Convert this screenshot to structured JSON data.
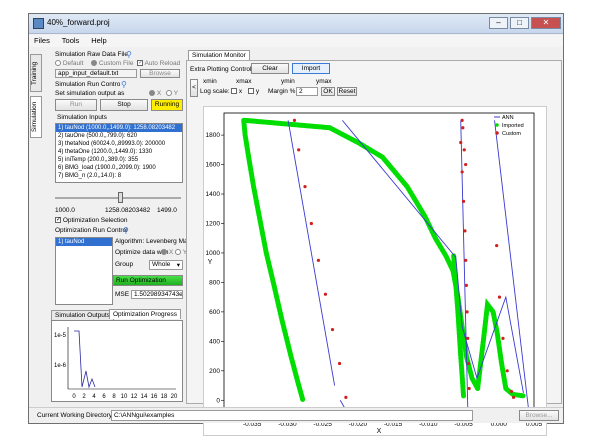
{
  "window": {
    "title": "40%_forward.proj"
  },
  "menu": [
    "Files",
    "Tools",
    "Help"
  ],
  "side_tabs": {
    "training": "Training",
    "simulation": "Simulation"
  },
  "raw_data": {
    "header": "Simulation Raw Data File",
    "default_label": "Default",
    "custom_label": "Custom File",
    "auto_reload_label": "Auto Reload",
    "file_value": "app_input_default.txt",
    "browse_label": "Browse"
  },
  "run_control": {
    "header": "Simulation Run Contro",
    "output_label": "Set simulation output as",
    "x_label": "X",
    "y_label": "Y",
    "run_label": "Run",
    "stop_label": "Stop",
    "running_label": "Running"
  },
  "inputs": {
    "header": "Simulation Inputs",
    "items": [
      "1)  tauNod   (1000.0,,1499.0): 1258.08203482",
      "2)  tauOne   (500.0,,799.0):  620",
      "3)  thetaNod  (60024.0,,89993.0):  200000",
      "4)  thetaOne  (1200.0,,1449.0):  1330",
      "5)  iniTemp  (200.0,,389.0):  355",
      "6)  BMG_load  (1900.0,,2099.0):  1900",
      "7)  BMG_n   (2.0,,14.0):  8"
    ],
    "slider_fraction": 0.52,
    "slider_min": "1000.0",
    "slider_value": "1258.08203482",
    "slider_max": "1499.0"
  },
  "optimization": {
    "selection_label": "Optimization Selection",
    "run_control_label": "Optimization Run Control",
    "list_items": [
      "1)  tauNod"
    ],
    "algorithm_label": "Algorithm: Levenberg Marquard",
    "optimize_with_label": "Optimize data with",
    "x_label": "X",
    "y_label": "Y",
    "group_label": "Group",
    "group_value": "Whole",
    "run_label": "Run Optimization",
    "mse_label": "MSE",
    "mse_value": "1.50298934743e-07"
  },
  "lower_tabs": {
    "outputs": "Simulation Outputs",
    "progress": "Optimization Progress"
  },
  "progress_chart": {
    "y_ticks": [
      "1e-5",
      "1e-6"
    ],
    "x_ticks": [
      "0",
      "2",
      "4",
      "6",
      "8",
      "10",
      "12",
      "14",
      "16",
      "18",
      "20"
    ]
  },
  "monitor": {
    "tab_label": "Simulation Monitor",
    "extra_label": "Extra Plotting Control",
    "clear_label": "Clear",
    "import_label": "Import",
    "collapse_label": "<",
    "xmin_label": "xmin",
    "xmax_label": "xmax",
    "ymin_label": "ymin",
    "ymax_label": "ymax",
    "log_scale_label": "Log scale:",
    "log_x_label": "x",
    "log_y_label": "y",
    "margin_label": "Margin %",
    "margin_value": "2",
    "ok_label": "OK",
    "reset_label": "Reset"
  },
  "chart_data": {
    "type": "scatter",
    "xlabel": "X",
    "ylabel": "Y",
    "xlim": [
      -0.039,
      0.005
    ],
    "ylim": [
      -100,
      1950
    ],
    "x_ticks": [
      "-0.035",
      "-0.030",
      "-0.025",
      "-0.020",
      "-0.015",
      "-0.010",
      "-0.005",
      "0.000",
      "0.005"
    ],
    "y_ticks": [
      "0",
      "200",
      "400",
      "600",
      "800",
      "1000",
      "1200",
      "1400",
      "1600",
      "1800"
    ],
    "legend": [
      "ANN",
      "Imported",
      "Custom"
    ],
    "legend_position": "top-right",
    "colors": {
      "ann": "#3a3acf",
      "imported": "#00dd00",
      "custom": "#d02020"
    },
    "series": [
      {
        "name": "ANN",
        "style": "line",
        "segments": [
          [
            [
              -0.0299,
              1900
            ],
            [
              -0.0233,
              100
            ]
          ],
          [
            [
              -0.0225,
              0
            ],
            [
              -0.0219,
              -50
            ]
          ],
          [
            [
              -0.0222,
              1900
            ],
            [
              -0.0061,
              970
            ],
            [
              -0.0052,
              500
            ],
            [
              -0.0031,
              150
            ],
            [
              0.001,
              700
            ],
            [
              0.0035,
              50
            ]
          ],
          [
            [
              -0.0054,
              1900
            ],
            [
              -0.0044,
              -50
            ]
          ],
          [
            [
              -0.0006,
              1900
            ],
            [
              0.0042,
              -50
            ]
          ]
        ]
      },
      {
        "name": "Imported",
        "style": "dots",
        "segments": [
          [
            [
              -0.0362,
              1900
            ],
            [
              -0.036,
              1800
            ],
            [
              -0.0355,
              1650
            ],
            [
              -0.0348,
              1450
            ],
            [
              -0.034,
              1250
            ],
            [
              -0.033,
              1000
            ],
            [
              -0.032,
              800
            ],
            [
              -0.0308,
              550
            ],
            [
              -0.0295,
              300
            ],
            [
              -0.0285,
              120
            ],
            [
              -0.0278,
              0
            ]
          ],
          [
            [
              -0.036,
              1900
            ],
            [
              -0.024,
              1850
            ],
            [
              -0.02,
              1750
            ],
            [
              -0.0165,
              1650
            ],
            [
              -0.013,
              1450
            ],
            [
              -0.0105,
              1250
            ],
            [
              -0.009,
              1100
            ],
            [
              -0.0075,
              980
            ],
            [
              -0.0065,
              880
            ],
            [
              -0.0058,
              700
            ],
            [
              -0.0052,
              500
            ],
            [
              -0.0046,
              300
            ],
            [
              -0.0038,
              150
            ],
            [
              -0.003,
              80
            ]
          ],
          [
            [
              -0.003,
              80
            ],
            [
              -0.0022,
              400
            ],
            [
              -0.0016,
              650
            ],
            [
              -0.0008,
              600
            ],
            [
              -0.0002,
              450
            ],
            [
              0.0004,
              250
            ],
            [
              0.001,
              80
            ],
            [
              0.002,
              40
            ],
            [
              0.0035,
              30
            ]
          ],
          [
            [
              -0.0064,
              980
            ],
            [
              -0.0058,
              600
            ],
            [
              -0.0054,
              300
            ],
            [
              -0.005,
              30
            ]
          ]
        ]
      },
      {
        "name": "Custom",
        "style": "markers",
        "points": [
          [
            -0.029,
            1900
          ],
          [
            -0.0284,
            1700
          ],
          [
            -0.0275,
            1450
          ],
          [
            -0.0266,
            1200
          ],
          [
            -0.0256,
            950
          ],
          [
            -0.0246,
            720
          ],
          [
            -0.0236,
            480
          ],
          [
            -0.0226,
            250
          ],
          [
            -0.0217,
            20
          ],
          [
            -0.0054,
            1750
          ],
          [
            -0.0052,
            1550
          ],
          [
            -0.005,
            1350
          ],
          [
            -0.0048,
            1150
          ],
          [
            -0.0047,
            950
          ],
          [
            -0.0046,
            780
          ],
          [
            -0.0045,
            600
          ],
          [
            -0.0044,
            420
          ],
          [
            -0.0043,
            250
          ],
          [
            -0.0042,
            80
          ],
          [
            -0.0052,
            1900
          ],
          [
            -0.0051,
            1850
          ],
          [
            -0.0049,
            1700
          ],
          [
            -0.0047,
            1600
          ],
          [
            -0.0003,
            1050
          ],
          [
            0.0001,
            700
          ],
          [
            0.0006,
            420
          ],
          [
            0.0012,
            200
          ],
          [
            0.0018,
            60
          ],
          [
            0.0021,
            20
          ]
        ]
      }
    ]
  },
  "status": {
    "dir_label": "Current Working Directory:",
    "dir_value": "C:\\ANNgui\\examples",
    "browse_label": "Browse..."
  }
}
